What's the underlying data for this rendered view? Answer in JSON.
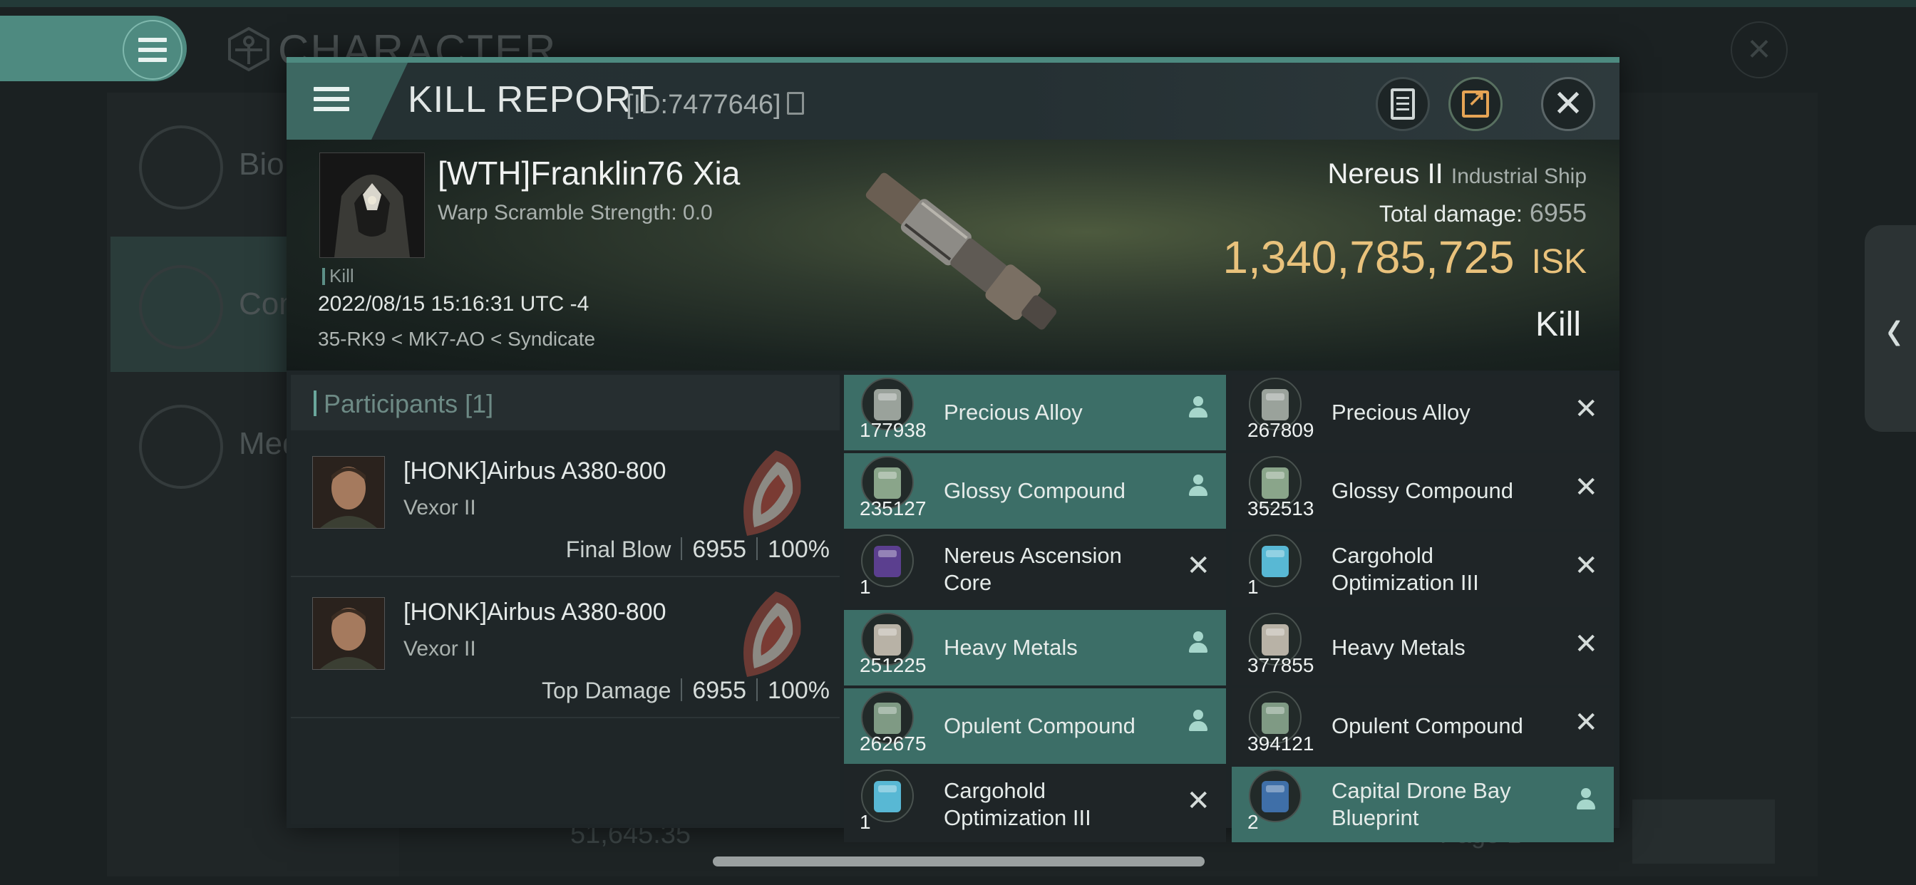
{
  "background": {
    "screen_title": "CHARACTER",
    "nav_items": [
      {
        "label": "Bio"
      },
      {
        "label": "Com"
      },
      {
        "label": "Med"
      }
    ],
    "wallet_value": "51,645.35",
    "page_label": "Page 1"
  },
  "report": {
    "title": "KILL REPORT",
    "id_label": "[ID:7477646]",
    "victim": {
      "name": "[WTH]Franklin76 Xia",
      "scramble": "Warp Scramble Strength: 0.0",
      "tag": "Kill",
      "datetime": "2022/08/15 15:16:31 UTC -4",
      "location": "35-RK9 < MK7-AO < Syndicate"
    },
    "ship": {
      "name": "Nereus II",
      "class": "Industrial Ship",
      "total_damage_label": "Total damage:",
      "total_damage": "6955",
      "isk_value": "1,340,785,725",
      "isk_unit": "ISK",
      "result": "Kill"
    },
    "participants": {
      "heading": "Participants [1]",
      "rows": [
        {
          "name": "[HONK]Airbus A380-800",
          "ship": "Vexor II",
          "role": "Final Blow",
          "damage": "6955",
          "percent": "100%"
        },
        {
          "name": "[HONK]Airbus A380-800",
          "ship": "Vexor II",
          "role": "Top Damage",
          "damage": "6955",
          "percent": "100%"
        }
      ]
    },
    "loot_left": [
      {
        "qty": "177938",
        "name": "Precious Alloy",
        "status": "dropped"
      },
      {
        "qty": "235127",
        "name": "Glossy Compound",
        "status": "dropped"
      },
      {
        "qty": "1",
        "name": "Nereus Ascension Core",
        "status": "destroyed"
      },
      {
        "qty": "251225",
        "name": "Heavy Metals",
        "status": "dropped"
      },
      {
        "qty": "262675",
        "name": "Opulent Compound",
        "status": "dropped"
      },
      {
        "qty": "1",
        "name": "Cargohold Optimization III",
        "status": "destroyed"
      }
    ],
    "loot_right": [
      {
        "qty": "267809",
        "name": "Precious Alloy",
        "status": "destroyed"
      },
      {
        "qty": "352513",
        "name": "Glossy Compound",
        "status": "destroyed"
      },
      {
        "qty": "1",
        "name": "Cargohold Optimization III",
        "status": "destroyed"
      },
      {
        "qty": "377855",
        "name": "Heavy Metals",
        "status": "destroyed"
      },
      {
        "qty": "394121",
        "name": "Opulent Compound",
        "status": "destroyed"
      },
      {
        "qty": "2",
        "name": "Capital Drone Bay Blueprint",
        "status": "dropped"
      }
    ]
  },
  "colors": {
    "accent": "#4d8a80",
    "dropped_row": "#3c6e67",
    "isk_gold": "#e9c27c"
  }
}
